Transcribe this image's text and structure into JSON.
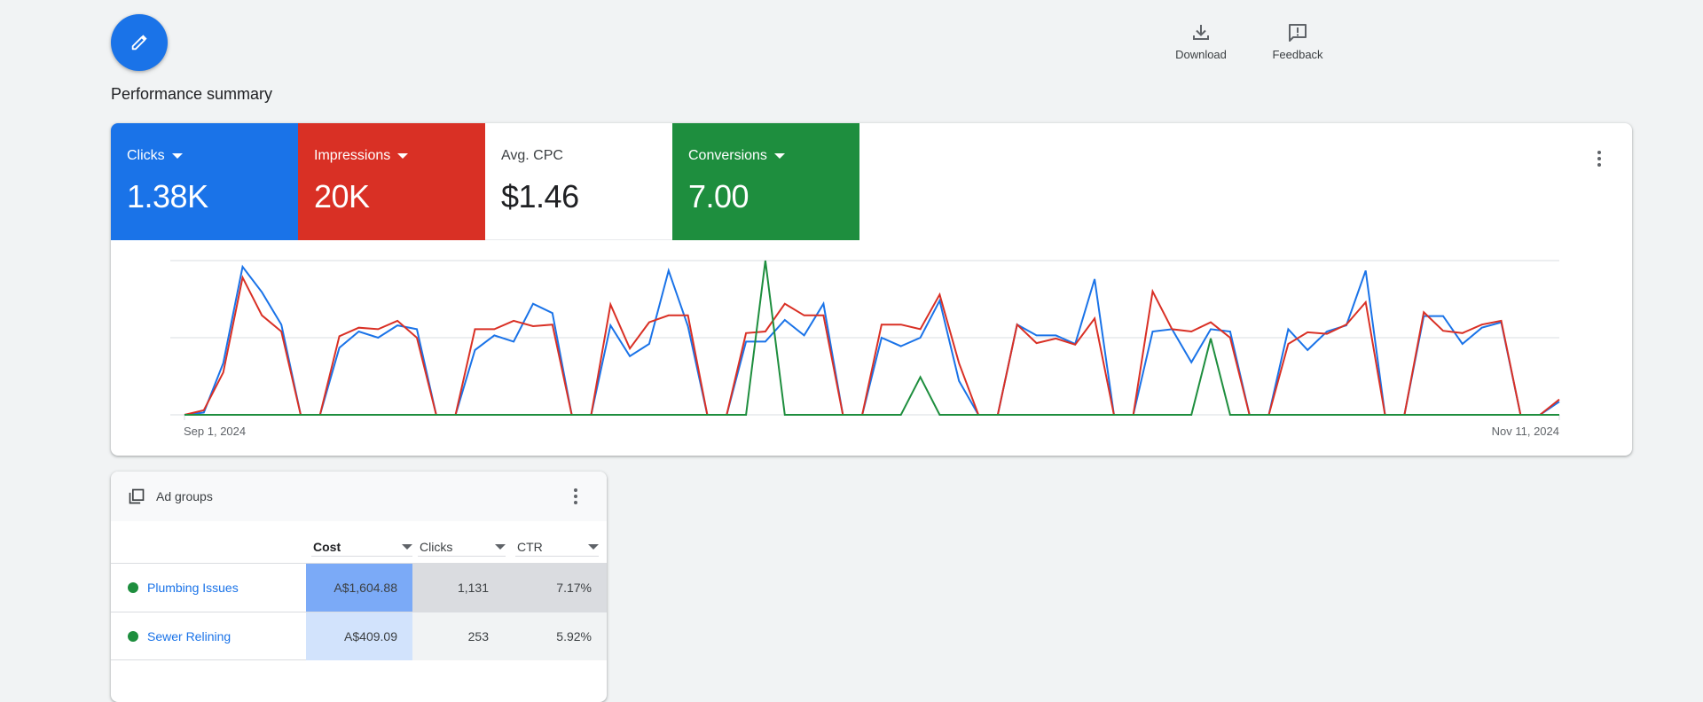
{
  "fab": {
    "icon": "pencil-icon"
  },
  "page_title": "Performance summary",
  "top_actions": [
    {
      "label": "Download",
      "icon": "download-icon"
    },
    {
      "label": "Feedback",
      "icon": "feedback-icon"
    }
  ],
  "metric_tiles": [
    {
      "label": "Clicks",
      "value": "1.38K",
      "has_dropdown": true,
      "color": "#1a73e8",
      "selected": true
    },
    {
      "label": "Impressions",
      "value": "20K",
      "has_dropdown": true,
      "color": "#d93025",
      "selected": true
    },
    {
      "label": "Avg. CPC",
      "value": "$1.46",
      "has_dropdown": false,
      "color": "#ffffff",
      "selected": false
    },
    {
      "label": "Conversions",
      "value": "7.00",
      "has_dropdown": true,
      "color": "#1e8e3e",
      "selected": true
    }
  ],
  "chart_data": {
    "type": "line",
    "title": "",
    "x_start_label": "Sep 1, 2024",
    "x_end_label": "Nov 11, 2024",
    "num_days": 72,
    "y_scale": "normalized per series (0 = baseline, 1 = middle gridline, 2 = top gridline)",
    "ylim": [
      0,
      2
    ],
    "grid": true,
    "series": [
      {
        "name": "Clicks",
        "color": "#1a73e8",
        "values": [
          0,
          0.03,
          0.67,
          1.92,
          1.59,
          1.17,
          0,
          0,
          0.87,
          1.08,
          1.0,
          1.16,
          1.11,
          0,
          0,
          0.84,
          1.03,
          0.95,
          1.44,
          1.32,
          0,
          0,
          1.16,
          0.76,
          0.92,
          1.87,
          1.15,
          0,
          0,
          0.95,
          0.95,
          1.23,
          1.03,
          1.44,
          0,
          0,
          1.0,
          0.89,
          1.0,
          1.48,
          0.44,
          0,
          0,
          1.17,
          1.03,
          1.03,
          0.92,
          1.76,
          0,
          0,
          1.08,
          1.11,
          0.68,
          1.11,
          1.08,
          0,
          0,
          1.11,
          0.84,
          1.08,
          1.16,
          1.87,
          0,
          0,
          1.28,
          1.28,
          0.92,
          1.13,
          1.2,
          0,
          0,
          0.17
        ]
      },
      {
        "name": "Impressions",
        "color": "#d93025",
        "values": [
          0,
          0.06,
          0.55,
          1.78,
          1.29,
          1.08,
          0,
          0,
          1.02,
          1.13,
          1.11,
          1.22,
          1.0,
          0,
          0,
          1.11,
          1.11,
          1.22,
          1.15,
          1.17,
          0,
          0,
          1.43,
          0.86,
          1.2,
          1.29,
          1.29,
          0,
          0,
          1.06,
          1.08,
          1.44,
          1.29,
          1.29,
          0,
          0,
          1.17,
          1.17,
          1.11,
          1.56,
          0.67,
          0,
          0,
          1.17,
          0.93,
          0.99,
          0.91,
          1.25,
          0,
          0,
          1.6,
          1.11,
          1.08,
          1.2,
          1.0,
          0,
          0,
          0.92,
          1.07,
          1.05,
          1.17,
          1.46,
          0,
          0,
          1.33,
          1.09,
          1.06,
          1.17,
          1.22,
          0,
          0,
          0.2
        ]
      },
      {
        "name": "Conversions",
        "color": "#1e8e3e",
        "values": [
          0,
          0,
          0,
          0,
          0,
          0,
          0,
          0,
          0,
          0,
          0,
          0,
          0,
          0,
          0,
          0,
          0,
          0,
          0,
          0,
          0,
          0,
          0,
          0,
          0,
          0,
          0,
          0,
          0,
          0,
          2.0,
          0,
          0,
          0,
          0,
          0,
          0,
          0,
          0.49,
          0,
          0,
          0,
          0,
          0,
          0,
          0,
          0,
          0,
          0,
          0,
          0,
          0,
          0,
          0.99,
          0,
          0,
          0,
          0,
          0,
          0,
          0,
          0,
          0,
          0,
          0,
          0,
          0,
          0,
          0,
          0,
          0,
          0
        ]
      }
    ]
  },
  "ad_groups": {
    "title": "Ad groups",
    "icon": "ad-groups-icon",
    "columns": [
      {
        "label": "Cost",
        "sorted": true
      },
      {
        "label": "Clicks",
        "sorted": false
      },
      {
        "label": "CTR",
        "sorted": false
      }
    ],
    "rows": [
      {
        "name": "Plumbing Issues",
        "status": "enabled",
        "cost": "A$1,604.88",
        "clicks": "1,131",
        "ctr": "7.17%"
      },
      {
        "name": "Sewer Relining",
        "status": "enabled",
        "cost": "A$409.09",
        "clicks": "253",
        "ctr": "5.92%"
      }
    ]
  }
}
